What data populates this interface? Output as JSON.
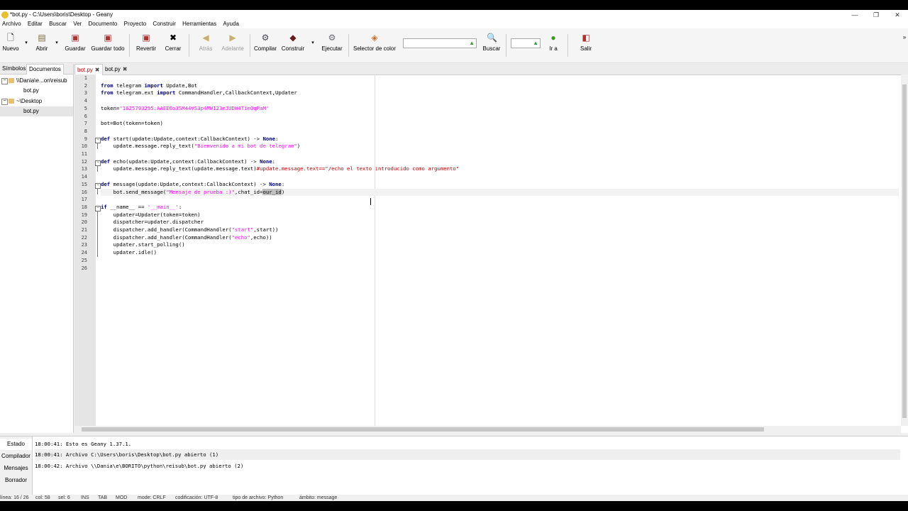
{
  "window": {
    "title": "*bot.py - C:\\Users\\boris\\Desktop - Geany",
    "controls": [
      "—",
      "❐",
      "✕"
    ]
  },
  "menu": [
    "Archivo",
    "Editar",
    "Buscar",
    "Ver",
    "Documento",
    "Proyecto",
    "Construir",
    "Herramientas",
    "Ayuda"
  ],
  "toolbar": {
    "nuevo": "Nuevo",
    "abrir": "Abrir",
    "guardar": "Guardar",
    "guardar_todo": "Guardar todo",
    "revertir": "Revertir",
    "cerrar": "Cerrar",
    "atras": "Atrás",
    "adelante": "Adelante",
    "compilar": "Compilar",
    "construir": "Construir",
    "ejecutar": "Ejecutar",
    "selector": "Selector de color",
    "buscar": "Buscar",
    "ir_a": "Ir a",
    "salir": "Salir",
    "search_value": "",
    "goto_value": ""
  },
  "sidebar": {
    "tabs": [
      "Símbolos",
      "Documentos"
    ],
    "tree": [
      {
        "label": "\\\\Dania\\e...on\\reisub",
        "type": "folder"
      },
      {
        "label": "bot.py",
        "type": "file"
      },
      {
        "label": "~\\Desktop",
        "type": "folder"
      },
      {
        "label": "bot.py",
        "type": "file"
      }
    ]
  },
  "editor": {
    "tabs": [
      {
        "label": "bot.py",
        "close": "✖"
      },
      {
        "label": "bot.py",
        "close": "✖"
      }
    ],
    "line_numbers": [
      "1",
      "2",
      "3",
      "4",
      "5",
      "6",
      "7",
      "8",
      "9",
      "10",
      "11",
      "12",
      "13",
      "14",
      "15",
      "16",
      "17",
      "18",
      "19",
      "20",
      "21",
      "22",
      "23",
      "24",
      "25",
      "26"
    ]
  },
  "messages": {
    "tabs": [
      "Estado",
      "Compilador",
      "Mensajes",
      "Borrador"
    ],
    "lines": [
      "18:00:41: Esto es Geany 1.37.1.",
      "18:00:41: Archivo C:\\Users\\boris\\Desktop\\bot.py abierto (1)",
      "18:00:42: Archivo \\\\Dania\\e\\BORITO\\python\\reisub\\bot.py abierto (2)"
    ]
  },
  "status": {
    "line": "línea: 16 / 26",
    "col": "col: 58",
    "sel": "sel: 6",
    "ins": "INS",
    "tab": "TAB",
    "mod": "MOD",
    "mode": "mode: CRLF",
    "enc": "codificación: UTF-8",
    "ftype": "tipo de archivo: Python",
    "scope": "ámbito: message"
  }
}
